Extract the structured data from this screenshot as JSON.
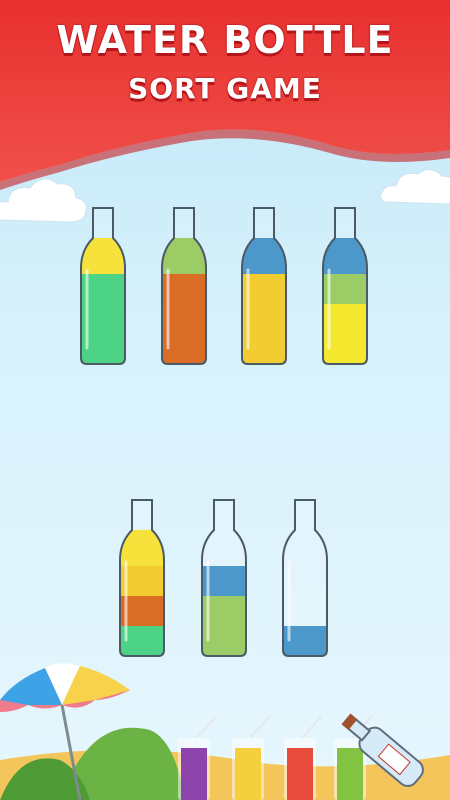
{
  "header": {
    "title_line1": "WATER BOTTLE",
    "title_line2": "SORT GAME"
  },
  "colors": {
    "banner_red": "#e8302f",
    "sky": "#cfeefb",
    "green": "#2ecc71",
    "orange": "#d35400",
    "yellow": "#f1c40f",
    "blue": "#2e86c1",
    "lime": "#8bc34a",
    "bright_yellow": "#f4e50c",
    "light_yellow": "#f5dd19"
  },
  "bottles": [
    {
      "name": "bottle-1",
      "layers_top_to_bottom": [
        "light_yellow",
        "green",
        "green",
        "green"
      ]
    },
    {
      "name": "bottle-2",
      "layers_top_to_bottom": [
        "lime",
        "orange",
        "orange",
        "orange"
      ]
    },
    {
      "name": "bottle-3",
      "layers_top_to_bottom": [
        "blue",
        "yellow",
        "yellow",
        "yellow"
      ]
    },
    {
      "name": "bottle-4",
      "layers_top_to_bottom": [
        "blue",
        "lime",
        "bright_yellow",
        "bright_yellow"
      ]
    },
    {
      "name": "bottle-5",
      "layers_top_to_bottom": [
        "light_yellow",
        "yellow",
        "orange",
        "green"
      ]
    },
    {
      "name": "bottle-6",
      "layers_top_to_bottom": [
        "empty",
        "blue",
        "lime",
        "lime"
      ]
    },
    {
      "name": "bottle-7",
      "layers_top_to_bottom": [
        "empty",
        "empty",
        "empty",
        "blue"
      ]
    }
  ],
  "decor": {
    "glasses": [
      "purple",
      "yellow",
      "red",
      "green"
    ],
    "icons": [
      "umbrella-icon",
      "message-bottle-icon",
      "cloud-icon"
    ]
  }
}
